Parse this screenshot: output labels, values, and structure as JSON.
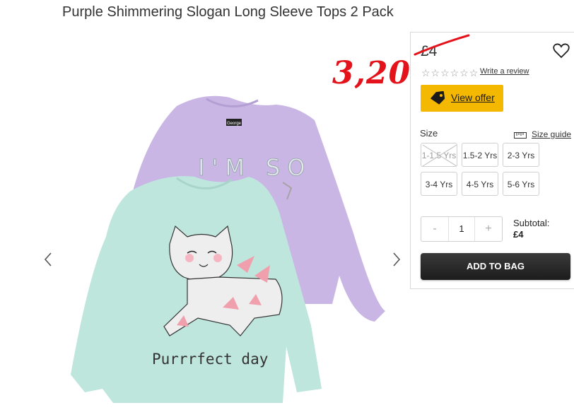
{
  "product": {
    "title": "Purple Shimmering Slogan Long Sleeve Tops 2 Pack",
    "price": "£4",
    "handwritten_price": "3,20",
    "rating_stars": "☆☆☆☆☆☆",
    "write_review": "Write a review",
    "offer_label": "View offer"
  },
  "size": {
    "label": "Size",
    "guide_label": "Size guide",
    "options": [
      {
        "label": "1-1.5 Yrs",
        "available": false
      },
      {
        "label": "1.5-2 Yrs",
        "available": true
      },
      {
        "label": "2-3 Yrs",
        "available": true
      },
      {
        "label": "3-4 Yrs",
        "available": true
      },
      {
        "label": "4-5 Yrs",
        "available": true
      },
      {
        "label": "5-6 Yrs",
        "available": true
      }
    ]
  },
  "quantity": {
    "minus": "-",
    "value": "1",
    "plus": "+"
  },
  "subtotal": {
    "label": "Subtotal:",
    "value": "£4"
  },
  "cart": {
    "add_label": "ADD TO BAG"
  },
  "image": {
    "purple_top_text": "I'M SO",
    "mint_top_text": "Purrrfect day",
    "neck_label": "George"
  },
  "colors": {
    "offer_yellow": "#f5b800",
    "add_button": "#222222",
    "handwriting_red": "#e3121b",
    "purple_top": "#c9b6e4",
    "mint_top": "#bfe6dd"
  },
  "icons": {
    "prev": "chevron-left-icon",
    "next": "chevron-right-icon",
    "wishlist": "heart-icon",
    "offer": "tag-icon",
    "size_guide": "ruler-icon"
  }
}
